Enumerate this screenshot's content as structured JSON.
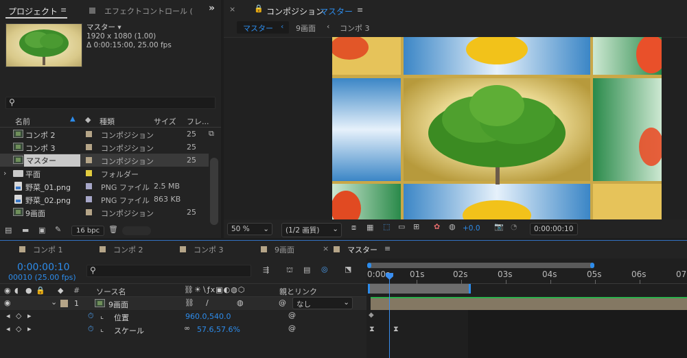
{
  "project": {
    "tab_label": "プロジェクト",
    "effect_tab_label": "エフェクトコントロール (",
    "preview_name": "マスター",
    "preview_dims": "1920 x 1080 (1.00)",
    "preview_duration": "Δ 0:00:15:00, 25.00 fps",
    "columns": {
      "name": "名前",
      "type": "種類",
      "size": "サイズ",
      "fr": "フレ..."
    },
    "items": [
      {
        "name": "コンポ 2",
        "type": "コンポジション",
        "size": "",
        "fr": "25",
        "kind": "comp",
        "color": "#b5a588"
      },
      {
        "name": "コンポ 3",
        "type": "コンポジション",
        "size": "",
        "fr": "25",
        "kind": "comp",
        "color": "#b5a588"
      },
      {
        "name": "マスター",
        "type": "コンポジション",
        "size": "",
        "fr": "25",
        "kind": "comp",
        "color": "#b5a588"
      },
      {
        "name": "平面",
        "type": "フォルダー",
        "size": "",
        "fr": "",
        "kind": "folder",
        "color": "#e2cc3f"
      },
      {
        "name": "野菜_01.png",
        "type": "PNG ファイル",
        "size": "2.5 MB",
        "fr": "",
        "kind": "file",
        "color": "#a7a7c8"
      },
      {
        "name": "野菜_02.png",
        "type": "PNG ファイル",
        "size": "863 KB",
        "fr": "",
        "kind": "file",
        "color": "#a7a7c8"
      },
      {
        "name": "9画面",
        "type": "コンポジション",
        "size": "",
        "fr": "25",
        "kind": "comp",
        "color": "#b5a588"
      }
    ],
    "bpc": "16 bpc"
  },
  "comp_panel": {
    "tab_title": "コンポジション",
    "tab_comp_name": "マスター",
    "breadcrumbs": [
      "マスター",
      "9画面",
      "コンポ 3"
    ],
    "zoom": "50 %",
    "resolution": "(1/2 画質)",
    "exposure": "+0.0",
    "timecode": "0:00:00:10"
  },
  "timeline": {
    "tabs": [
      "コンポ 1",
      "コンポ 2",
      "コンポ 3",
      "9画面",
      "マスター"
    ],
    "tab_colors": [
      "#b5a588",
      "#b5a588",
      "#b5a588",
      "#b5a588",
      "#b5a588"
    ],
    "timecode": "0:00:00:10",
    "frame_info": "00010 (25.00 fps)",
    "col_source": "ソース名",
    "col_parent": "親とリンク",
    "col_hash": "#",
    "layer": {
      "num": "1",
      "name": "9画面",
      "parent": "なし"
    },
    "props": [
      {
        "name": "位置",
        "value": "960.0,540.0"
      },
      {
        "name": "スケール",
        "value": "57.6,57.6%"
      }
    ],
    "ruler": [
      "0:00s",
      "01s",
      "02s",
      "03s",
      "04s",
      "05s",
      "06s",
      "07"
    ]
  }
}
